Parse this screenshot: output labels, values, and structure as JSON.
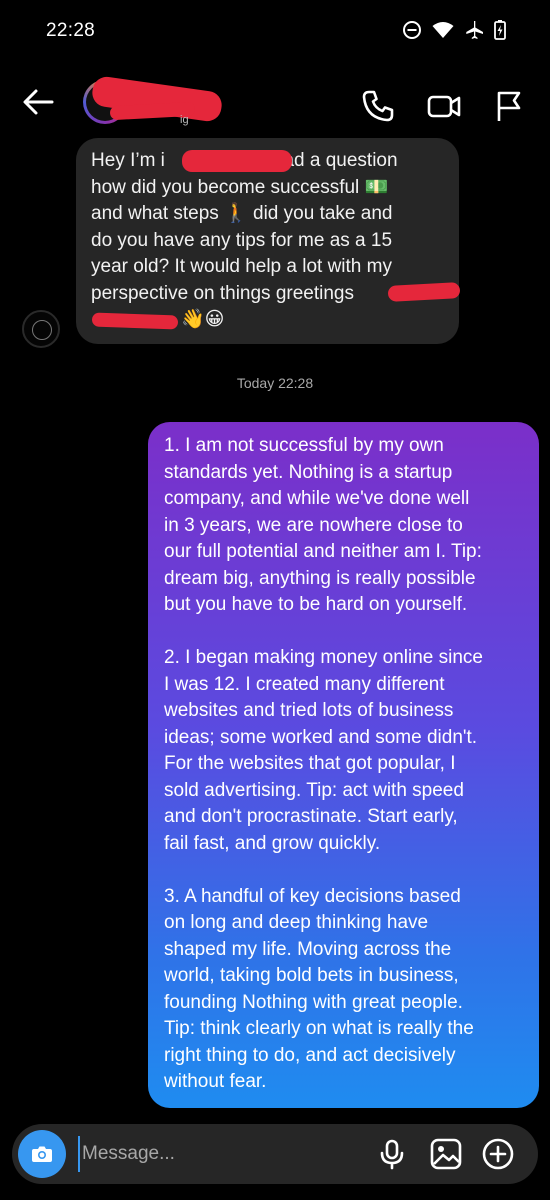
{
  "status_bar": {
    "time": "22:28"
  },
  "header": {
    "sub_fragment": "ig"
  },
  "incoming": {
    "lines": [
      "Hey I’m i",
      "had a question",
      "how did you become successful 💵",
      "and what steps 🚶 did you take and",
      "do you have any tips for me as a 15",
      "year old? It would help a lot with my",
      "perspective on things greetings",
      "👋😀"
    ]
  },
  "timestamp": "Today 22:28",
  "outgoing": {
    "paragraphs": [
      "1. I am not successful by my own standards yet. Nothing is a startup company, and while we've done well in 3 years, we are nowhere close to our full potential and neither am I. Tip: dream big, anything is really possible but you have to be hard on yourself.",
      "2. I began making money online since I was 12. I created many different websites and tried lots of business ideas; some worked and some didn't. For the websites that got popular, I sold advertising. Tip: act with speed and don't procrastinate. Start early, fail fast, and grow quickly.",
      "3. A handful of key decisions based on long and deep thinking have shaped my life. Moving across the world, taking bold bets in business, founding Nothing with great people. Tip: think clearly on what is really the right thing to do, and act decisively without fear."
    ],
    "display_lines": [
      "1. I am not successful by my own\nstandards yet. Nothing is a startup\ncompany, and while we've done well\nin 3 years, we are nowhere close to\nour full potential and neither am I. Tip:\ndream big, anything is really possible\nbut you have to be hard on yourself.",
      "2. I began making money online since\nI was 12. I created many different\nwebsites and tried lots of business\nideas; some worked and some didn't.\nFor the websites that got popular, I\nsold advertising. Tip: act with speed\nand don't procrastinate. Start early,\nfail fast, and grow quickly.",
      "3. A handful of key decisions based\non long and deep thinking have\nshaped my life. Moving across the\nworld, taking bold bets in business,\nfounding Nothing with great people.\nTip: think clearly on what is really the\nright thing to do, and act decisively\nwithout fear."
    ]
  },
  "composer": {
    "placeholder": "Message..."
  },
  "colors": {
    "accent": "#3797f0",
    "bubble_in": "#262626",
    "gradient_top": "#7b2fc9",
    "gradient_bottom": "#1f8cf0",
    "redaction": "#e5273b"
  },
  "icons": [
    "back-arrow-icon",
    "phone-icon",
    "video-icon",
    "flag-icon",
    "camera-icon",
    "microphone-icon",
    "image-icon",
    "plus-circle-icon"
  ]
}
